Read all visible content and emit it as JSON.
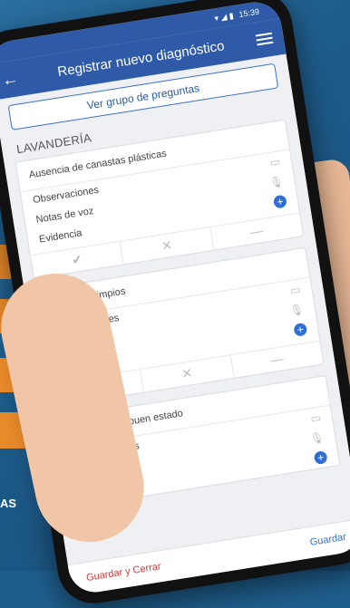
{
  "background": {
    "banner_text_1": "AS"
  },
  "status": {
    "time": "15:39"
  },
  "app": {
    "title": "Registrar nuevo diagnóstico"
  },
  "group_button": "Ver grupo de preguntas",
  "section": "LAVANDERÍA",
  "questions": [
    {
      "title": "Ausencia de canastas plásticas"
    },
    {
      "title": "Utensilios limpios"
    },
    {
      "title": "Utensilios en buen estado"
    }
  ],
  "fields": {
    "observations": "Observaciones",
    "voice_notes": "Notas de voz",
    "evidence": "Evidencia"
  },
  "answers": {
    "yes": "✔",
    "no": "✕",
    "na": "—"
  },
  "footer": {
    "save_close": "Guardar y Cerrar",
    "save": "Guardar"
  },
  "colors": {
    "primary": "#2e5aa8",
    "accent_red": "#d23a3a",
    "brand_orange": "#e98a2b"
  }
}
